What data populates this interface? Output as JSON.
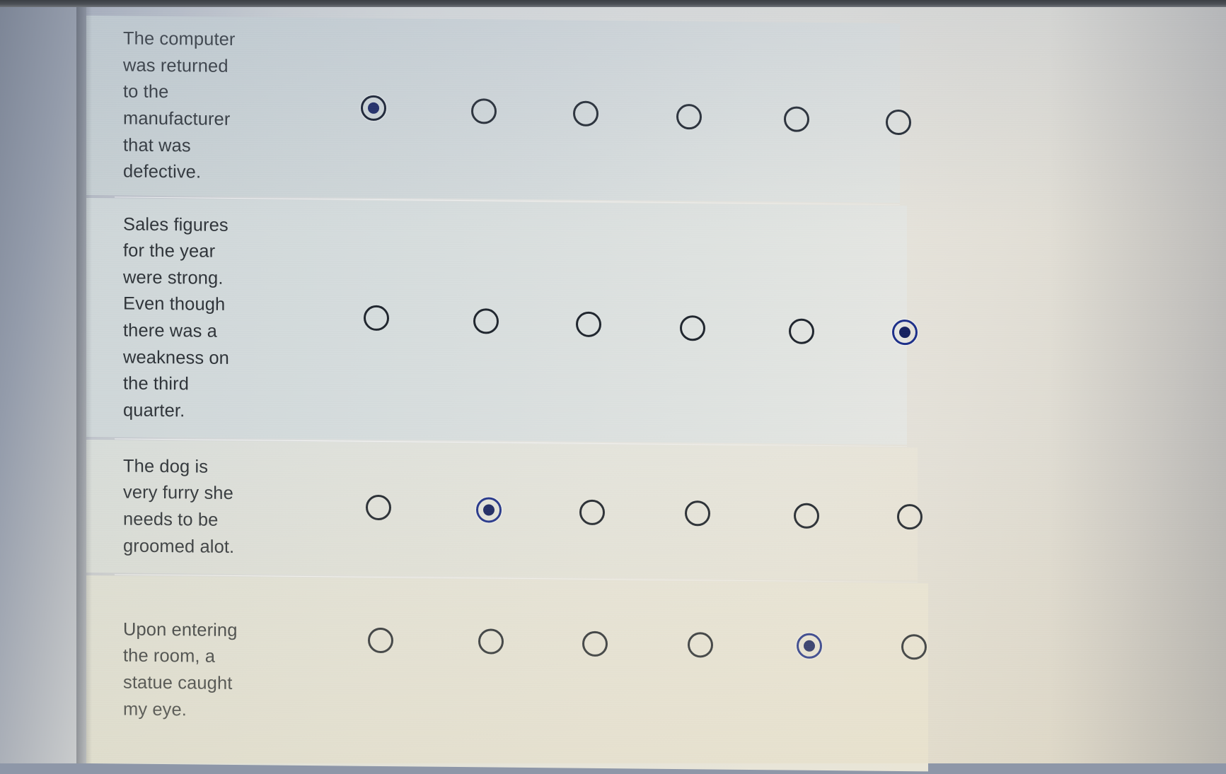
{
  "survey": {
    "scale_points": 6,
    "selected_color": "#1d2f86",
    "rows": [
      {
        "prompt": "The computer\nwas returned\nto the\nmanufacturer\nthat was\ndefective.",
        "selected_index": 0,
        "options": [
          "option-1",
          "option-2",
          "option-3",
          "option-4",
          "option-5",
          "option-6"
        ]
      },
      {
        "prompt": "Sales figures\nfor the year\nwere strong.\nEven though\nthere was a\nweakness on\nthe third\nquarter.",
        "selected_index": 5,
        "options": [
          "option-1",
          "option-2",
          "option-3",
          "option-4",
          "option-5",
          "option-6"
        ]
      },
      {
        "prompt": "The dog is\nvery furry she\nneeds to be\ngroomed alot.",
        "selected_index": 1,
        "options": [
          "option-1",
          "option-2",
          "option-3",
          "option-4",
          "option-5",
          "option-6"
        ]
      },
      {
        "prompt": "Upon entering\nthe room, a\nstatue caught\nmy eye.",
        "selected_index": 4,
        "options": [
          "option-1",
          "option-2",
          "option-3",
          "option-4",
          "option-5",
          "option-6"
        ]
      }
    ]
  }
}
